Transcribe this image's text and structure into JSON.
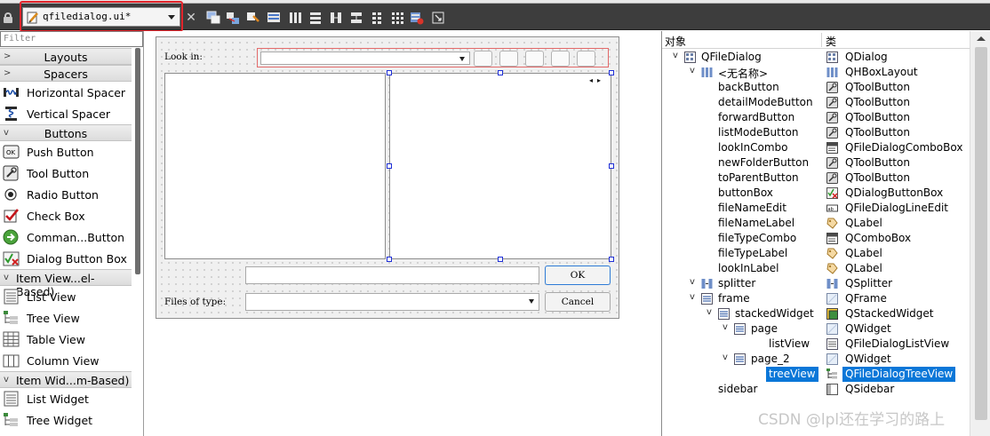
{
  "toolbar": {
    "file_name": "qfiledialog.ui*",
    "close_symbol": "✕",
    "icons": [
      "edit-widgets-icon",
      "edit-signals-slots-icon",
      "edit-buddies-icon",
      "edit-tab-order-icon",
      "lay-out-horizontally-icon",
      "lay-out-vertically-icon",
      "horizontal-splitter-icon",
      "vertical-splitter-icon",
      "form-layout-icon",
      "grid-layout-icon",
      "break-layout-icon",
      "adjust-size-icon"
    ]
  },
  "widget_box": {
    "filter_placeholder": "Filter",
    "cat_layouts": "Layouts",
    "cat_spacers": "Spacers",
    "horizontal_spacer": "Horizontal Spacer",
    "vertical_spacer": "Vertical Spacer",
    "cat_buttons": "Buttons",
    "push_button": "Push Button",
    "tool_button": "Tool Button",
    "radio_button": "Radio Button",
    "check_box": "Check Box",
    "command_button": "Comman...Button",
    "dialog_button_box": "Dialog Button Box",
    "cat_item_views": "Item View...el-Based)",
    "list_view": "List View",
    "tree_view": "Tree View",
    "table_view": "Table View",
    "column_view": "Column View",
    "cat_item_widgets": "Item Wid...m-Based)",
    "list_widget": "List Widget",
    "tree_widget": "Tree Widget"
  },
  "form": {
    "look_in_label": "Look in:",
    "ok_label": "OK",
    "files_of_type_label": "Files of type:",
    "cancel_label": "Cancel",
    "nav_arrows": "◂▸"
  },
  "inspector": {
    "col_object": "对象",
    "col_class": "类",
    "rows": [
      {
        "name": "QFileDialog",
        "class": "QDialog"
      },
      {
        "name": "<无名称>",
        "class": "QHBoxLayout"
      },
      {
        "name": "backButton",
        "class": "QToolButton"
      },
      {
        "name": "detailModeButton",
        "class": "QToolButton"
      },
      {
        "name": "forwardButton",
        "class": "QToolButton"
      },
      {
        "name": "listModeButton",
        "class": "QToolButton"
      },
      {
        "name": "lookInCombo",
        "class": "QFileDialogComboBox"
      },
      {
        "name": "newFolderButton",
        "class": "QToolButton"
      },
      {
        "name": "toParentButton",
        "class": "QToolButton"
      },
      {
        "name": "buttonBox",
        "class": "QDialogButtonBox"
      },
      {
        "name": "fileNameEdit",
        "class": "QFileDialogLineEdit"
      },
      {
        "name": "fileNameLabel",
        "class": "QLabel"
      },
      {
        "name": "fileTypeCombo",
        "class": "QComboBox"
      },
      {
        "name": "fileTypeLabel",
        "class": "QLabel"
      },
      {
        "name": "lookInLabel",
        "class": "QLabel"
      },
      {
        "name": "splitter",
        "class": "QSplitter"
      },
      {
        "name": "frame",
        "class": "QFrame"
      },
      {
        "name": "stackedWidget",
        "class": "QStackedWidget"
      },
      {
        "name": "page",
        "class": "QWidget"
      },
      {
        "name": "listView",
        "class": "QFileDialogListView"
      },
      {
        "name": "page_2",
        "class": "QWidget"
      },
      {
        "name": "treeView",
        "class": "QFileDialogTreeView"
      },
      {
        "name": "sidebar",
        "class": "QSidebar"
      }
    ]
  },
  "watermark": "CSDN @lpl还在学习的路上",
  "colors": {
    "toolbar_bg": "#3d3d3d",
    "highlight_red": "#e3242b",
    "selection_blue": "#0a77d8",
    "handle_blue": "#1f2fd6"
  }
}
